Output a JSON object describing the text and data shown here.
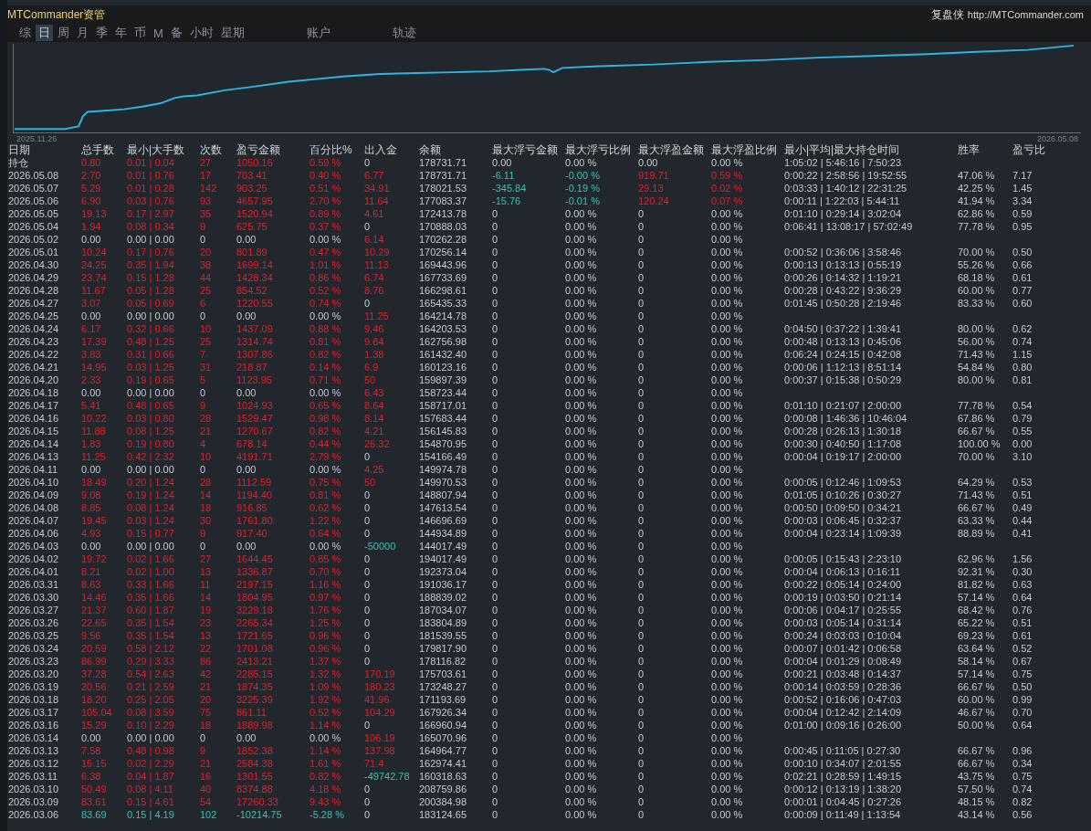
{
  "window": {
    "title": "MTCommander资管",
    "brand": "复盘侠",
    "url": "http://MTCommander.com"
  },
  "tabs": [
    {
      "label": "综",
      "selected": false
    },
    {
      "label": "日",
      "selected": true
    },
    {
      "label": "周",
      "selected": false
    },
    {
      "label": "月",
      "selected": false
    },
    {
      "label": "季",
      "selected": false
    },
    {
      "label": "年",
      "selected": false
    },
    {
      "label": "币",
      "selected": false
    },
    {
      "label": "M",
      "selected": false
    },
    {
      "label": "备",
      "selected": false
    },
    {
      "label": "小时",
      "selected": false
    },
    {
      "label": "星期",
      "selected": false
    },
    {
      "label": "账户",
      "selected": false
    },
    {
      "label": "轨迹",
      "selected": false
    }
  ],
  "chart": {
    "start_label": "2025.11.26",
    "end_label": "2026.05.08"
  },
  "table": {
    "columns": [
      "日期",
      "总手数",
      "最小|大手数",
      "次数",
      "盈亏金额",
      "百分比%",
      "出入金",
      "余额",
      "最大浮亏金额",
      "最大浮亏比例",
      "最大浮盈金额",
      "最大浮盈比例",
      "最小|平均|最大持仓时间",
      "胜率",
      "盈亏比"
    ],
    "rows": [
      {
        "kind": "gain",
        "deposit": false,
        "withdrawal": false,
        "floating": false,
        "cells": [
          "持仓",
          "0.80",
          "0.01 | 0.04",
          "27",
          "1050.16",
          "0.59 %",
          "0",
          "178731.71",
          "0.00",
          "0.00 %",
          "0.00",
          "0.00 %",
          "1:05:02 | 5:46:16 | 7:50:23"
        ]
      },
      {
        "kind": "gain",
        "deposit": true,
        "withdrawal": false,
        "floating": true,
        "cells": [
          "2026.05.08",
          "2.70",
          "0.01 | 0.76",
          "17",
          "703.41",
          "0.40 %",
          "6.77",
          "178731.71",
          "-6.11",
          "-0.00 %",
          "919.71",
          "0.59 %",
          "0:00:22 | 2:58:56 | 19:52:55",
          "47.06 %",
          "7.17"
        ]
      },
      {
        "kind": "gain",
        "deposit": true,
        "withdrawal": false,
        "floating": true,
        "cells": [
          "2026.05.07",
          "5.29",
          "0.01 | 0.28",
          "142",
          "903.25",
          "0.51 %",
          "34.91",
          "178021.53",
          "-345.84",
          "-0.19 %",
          "29.13",
          "0.02 %",
          "0:03:33 | 1:40:12 | 22:31:25",
          "42.25 %",
          "1.45"
        ]
      },
      {
        "kind": "gain",
        "deposit": true,
        "withdrawal": false,
        "floating": true,
        "cells": [
          "2026.05.06",
          "6.90",
          "0.03 | 0.76",
          "93",
          "4657.95",
          "2.70 %",
          "11.64",
          "177083.37",
          "-15.76",
          "-0.01 %",
          "120.24",
          "0.07 %",
          "0:00:11 | 1:22:03 | 5:44:11",
          "41.94 %",
          "3.34"
        ]
      },
      {
        "kind": "gain",
        "deposit": true,
        "withdrawal": false,
        "floating": false,
        "cells": [
          "2026.05.05",
          "19.13",
          "0.17 | 2.97",
          "35",
          "1520.94",
          "0.89 %",
          "4.61",
          "172413.78",
          "0",
          "0.00 %",
          "0",
          "0.00 %",
          "0:01:10 | 0:29:14 | 3:02:04",
          "62.86 %",
          "0.59"
        ]
      },
      {
        "kind": "gain",
        "deposit": false,
        "withdrawal": false,
        "floating": false,
        "cells": [
          "2026.05.04",
          "1.94",
          "0.08 | 0.34",
          "9",
          "625.75",
          "0.37 %",
          "0",
          "170888.03",
          "0",
          "0.00 %",
          "0",
          "0.00 %",
          "0:06:41 | 13:08:17 | 57:02:49",
          "77.78 %",
          "0.95"
        ]
      },
      {
        "kind": "flat",
        "deposit": true,
        "withdrawal": false,
        "floating": false,
        "cells": [
          "2026.05.02",
          "0.00",
          "0.00 | 0.00",
          "0",
          "0.00",
          "0.00 %",
          "6.14",
          "170262.28",
          "0",
          "0.00 %",
          "0",
          "0.00 %"
        ]
      },
      {
        "kind": "gain",
        "deposit": true,
        "withdrawal": false,
        "floating": false,
        "cells": [
          "2026.05.01",
          "10.24",
          "0.17 | 0.76",
          "20",
          "801.89",
          "0.47 %",
          "10.29",
          "170256.14",
          "0",
          "0.00 %",
          "0",
          "0.00 %",
          "0:00:52 | 0:36:06 | 3:58:46",
          "70.00 %",
          "0.50"
        ]
      },
      {
        "kind": "gain",
        "deposit": true,
        "withdrawal": false,
        "floating": false,
        "cells": [
          "2026.04.30",
          "24.25",
          "0.35 | 1.94",
          "38",
          "1699.14",
          "1.01 %",
          "11.13",
          "169443.96",
          "0",
          "0.00 %",
          "0",
          "0.00 %",
          "0:00:13 | 0:13:13 | 0:55:19",
          "55.26 %",
          "0.66"
        ]
      },
      {
        "kind": "gain",
        "deposit": true,
        "withdrawal": false,
        "floating": false,
        "cells": [
          "2026.04.29",
          "23.74",
          "0.15 | 1.28",
          "44",
          "1428.34",
          "0.86 %",
          "6.74",
          "167733.69",
          "0",
          "0.00 %",
          "0",
          "0.00 %",
          "0:00:26 | 0:14:32 | 1:19:21",
          "68.18 %",
          "0.61"
        ]
      },
      {
        "kind": "gain",
        "deposit": true,
        "withdrawal": false,
        "floating": false,
        "cells": [
          "2026.04.28",
          "11.67",
          "0.05 | 1.28",
          "25",
          "854.52",
          "0.52 %",
          "8.76",
          "166298.61",
          "0",
          "0.00 %",
          "0",
          "0.00 %",
          "0:00:28 | 0:43:22 | 9:36:29",
          "60.00 %",
          "0.77"
        ]
      },
      {
        "kind": "gain",
        "deposit": false,
        "withdrawal": false,
        "floating": false,
        "cells": [
          "2026.04.27",
          "3.07",
          "0.05 | 0.69",
          "6",
          "1220.55",
          "0.74 %",
          "0",
          "165435.33",
          "0",
          "0.00 %",
          "0",
          "0.00 %",
          "0:01:45 | 0:50:28 | 2:19:46",
          "83.33 %",
          "0.60"
        ]
      },
      {
        "kind": "flat",
        "deposit": true,
        "withdrawal": false,
        "floating": false,
        "cells": [
          "2026.04.25",
          "0.00",
          "0.00 | 0.00",
          "0",
          "0.00",
          "0.00 %",
          "11.25",
          "164214.78",
          "0",
          "0.00 %",
          "0",
          "0.00 %"
        ]
      },
      {
        "kind": "gain",
        "deposit": true,
        "withdrawal": false,
        "floating": false,
        "cells": [
          "2026.04.24",
          "6.17",
          "0.32 | 0.66",
          "10",
          "1437.09",
          "0.88 %",
          "9.46",
          "164203.53",
          "0",
          "0.00 %",
          "0",
          "0.00 %",
          "0:04:50 | 0:37:22 | 1:39:41",
          "80.00 %",
          "0.62"
        ]
      },
      {
        "kind": "gain",
        "deposit": true,
        "withdrawal": false,
        "floating": false,
        "cells": [
          "2026.04.23",
          "17.39",
          "0.48 | 1.25",
          "25",
          "1314.74",
          "0.81 %",
          "9.84",
          "162756.98",
          "0",
          "0.00 %",
          "0",
          "0.00 %",
          "0:00:48 | 0:13:13 | 0:45:06",
          "56.00 %",
          "0.74"
        ]
      },
      {
        "kind": "gain",
        "deposit": true,
        "withdrawal": false,
        "floating": false,
        "cells": [
          "2026.04.22",
          "3.83",
          "0.31 | 0.66",
          "7",
          "1307.86",
          "0.82 %",
          "1.38",
          "161432.40",
          "0",
          "0.00 %",
          "0",
          "0.00 %",
          "0:06:24 | 0:24:15 | 0:42:08",
          "71.43 %",
          "1.15"
        ]
      },
      {
        "kind": "gain",
        "deposit": true,
        "withdrawal": false,
        "floating": false,
        "cells": [
          "2026.04.21",
          "14.95",
          "0.03 | 1.25",
          "31",
          "218.87",
          "0.14 %",
          "6.9",
          "160123.16",
          "0",
          "0.00 %",
          "0",
          "0.00 %",
          "0:00:06 | 1:12:13 | 8:51:14",
          "54.84 %",
          "0.80"
        ]
      },
      {
        "kind": "gain",
        "deposit": true,
        "withdrawal": false,
        "floating": false,
        "cells": [
          "2026.04.20",
          "2.33",
          "0.19 | 0.65",
          "5",
          "1123.95",
          "0.71 %",
          "50",
          "159897.39",
          "0",
          "0.00 %",
          "0",
          "0.00 %",
          "0:00:37 | 0:15:38 | 0:50:29",
          "80.00 %",
          "0.81"
        ]
      },
      {
        "kind": "flat",
        "deposit": true,
        "withdrawal": false,
        "floating": false,
        "cells": [
          "2026.04.18",
          "0.00",
          "0.00 | 0.00",
          "0",
          "0.00",
          "0.00 %",
          "6.43",
          "158723.44",
          "0",
          "0.00 %",
          "0",
          "0.00 %"
        ]
      },
      {
        "kind": "gain",
        "deposit": true,
        "withdrawal": false,
        "floating": false,
        "cells": [
          "2026.04.17",
          "5.41",
          "0.48 | 0.65",
          "9",
          "1024.93",
          "0.65 %",
          "8.64",
          "158717.01",
          "0",
          "0.00 %",
          "0",
          "0.00 %",
          "0:01:10 | 0:21:07 | 2:00:00",
          "77.78 %",
          "0.54"
        ]
      },
      {
        "kind": "gain",
        "deposit": true,
        "withdrawal": false,
        "floating": false,
        "cells": [
          "2026.04.16",
          "10.22",
          "0.03 | 0.80",
          "28",
          "1529.47",
          "0.98 %",
          "8.14",
          "157683.44",
          "0",
          "0.00 %",
          "0",
          "0.00 %",
          "0:00:08 | 1:46:36 | 10:46:04",
          "67.86 %",
          "0.79"
        ]
      },
      {
        "kind": "gain",
        "deposit": true,
        "withdrawal": false,
        "floating": false,
        "cells": [
          "2026.04.15",
          "11.88",
          "0.08 | 1.25",
          "21",
          "1270.67",
          "0.82 %",
          "4.21",
          "156145.83",
          "0",
          "0.00 %",
          "0",
          "0.00 %",
          "0:00:28 | 0:26:13 | 1:30:18",
          "66.67 %",
          "0.55"
        ]
      },
      {
        "kind": "gain",
        "deposit": true,
        "withdrawal": false,
        "floating": false,
        "cells": [
          "2026.04.14",
          "1.83",
          "0.19 | 0.80",
          "4",
          "678.14",
          "0.44 %",
          "26.32",
          "154870.95",
          "0",
          "0.00 %",
          "0",
          "0.00 %",
          "0:00:30 | 0:40:50 | 1:17:08",
          "100.00 %",
          "0.00"
        ]
      },
      {
        "kind": "gain",
        "deposit": false,
        "withdrawal": false,
        "floating": false,
        "cells": [
          "2026.04.13",
          "11.25",
          "0.42 | 2.32",
          "10",
          "4191.71",
          "2.79 %",
          "0",
          "154166.49",
          "0",
          "0.00 %",
          "0",
          "0.00 %",
          "0:00:04 | 0:19:17 | 2:00:00",
          "70.00 %",
          "3.10"
        ]
      },
      {
        "kind": "flat",
        "deposit": true,
        "withdrawal": false,
        "floating": false,
        "cells": [
          "2026.04.11",
          "0.00",
          "0.00 | 0.00",
          "0",
          "0.00",
          "0.00 %",
          "4.25",
          "149974.78",
          "0",
          "0.00 %",
          "0",
          "0.00 %"
        ]
      },
      {
        "kind": "gain",
        "deposit": true,
        "withdrawal": false,
        "floating": false,
        "cells": [
          "2026.04.10",
          "18.49",
          "0.20 | 1.24",
          "28",
          "1112.59",
          "0.75 %",
          "50",
          "149970.53",
          "0",
          "0.00 %",
          "0",
          "0.00 %",
          "0:00:05 | 0:12:46 | 1:09:53",
          "64.29 %",
          "0.53"
        ]
      },
      {
        "kind": "gain",
        "deposit": false,
        "withdrawal": false,
        "floating": false,
        "cells": [
          "2026.04.09",
          "9.08",
          "0.19 | 1.24",
          "14",
          "1194.40",
          "0.81 %",
          "0",
          "148807.94",
          "0",
          "0.00 %",
          "0",
          "0.00 %",
          "0:01:05 | 0:10:26 | 0:30:27",
          "71.43 %",
          "0.51"
        ]
      },
      {
        "kind": "gain",
        "deposit": false,
        "withdrawal": false,
        "floating": false,
        "cells": [
          "2026.04.08",
          "8.85",
          "0.08 | 1.24",
          "18",
          "916.85",
          "0.62 %",
          "0",
          "147613.54",
          "0",
          "0.00 %",
          "0",
          "0.00 %",
          "0:00:50 | 0:09:50 | 0:34:21",
          "66.67 %",
          "0.49"
        ]
      },
      {
        "kind": "gain",
        "deposit": false,
        "withdrawal": false,
        "floating": false,
        "cells": [
          "2026.04.07",
          "19.45",
          "0.03 | 1.24",
          "30",
          "1761.80",
          "1.22 %",
          "0",
          "146696.69",
          "0",
          "0.00 %",
          "0",
          "0.00 %",
          "0:00:03 | 0:06:45 | 0:32:37",
          "63.33 %",
          "0.44"
        ]
      },
      {
        "kind": "gain",
        "deposit": false,
        "withdrawal": false,
        "floating": false,
        "cells": [
          "2026.04.06",
          "4.93",
          "0.15 | 0.77",
          "9",
          "917.40",
          "0.64 %",
          "0",
          "144934.89",
          "0",
          "0.00 %",
          "0",
          "0.00 %",
          "0:00:04 | 0:23:14 | 1:09:39",
          "88.89 %",
          "0.41"
        ]
      },
      {
        "kind": "flat",
        "deposit": false,
        "withdrawal": true,
        "floating": false,
        "cells": [
          "2026.04.03",
          "0.00",
          "0.00 | 0.00",
          "0",
          "0.00",
          "0.00 %",
          "-50000",
          "144017.49",
          "0",
          "0.00 %",
          "0",
          "0.00 %"
        ]
      },
      {
        "kind": "gain",
        "deposit": false,
        "withdrawal": false,
        "floating": false,
        "cells": [
          "2026.04.02",
          "19.72",
          "0.02 | 1.66",
          "27",
          "1644.45",
          "0.85 %",
          "0",
          "194017.49",
          "0",
          "0.00 %",
          "0",
          "0.00 %",
          "0:00:05 | 0:15:43 | 2:23:10",
          "62.96 %",
          "1.56"
        ]
      },
      {
        "kind": "gain",
        "deposit": false,
        "withdrawal": false,
        "floating": false,
        "cells": [
          "2026.04.01",
          "8.21",
          "0.02 | 1.00",
          "13",
          "1336.87",
          "0.70 %",
          "0",
          "192373.04",
          "0",
          "0.00 %",
          "0",
          "0.00 %",
          "0:00:04 | 0:06:13 | 0:16:11",
          "92.31 %",
          "0.30"
        ]
      },
      {
        "kind": "gain",
        "deposit": false,
        "withdrawal": false,
        "floating": false,
        "cells": [
          "2026.03.31",
          "8.63",
          "0.33 | 1.66",
          "11",
          "2197.15",
          "1.16 %",
          "0",
          "191036.17",
          "0",
          "0.00 %",
          "0",
          "0.00 %",
          "0:00:22 | 0:05:14 | 0:24:00",
          "81.82 %",
          "0.63"
        ]
      },
      {
        "kind": "gain",
        "deposit": false,
        "withdrawal": false,
        "floating": false,
        "cells": [
          "2026.03.30",
          "14.46",
          "0.35 | 1.66",
          "14",
          "1804.95",
          "0.97 %",
          "0",
          "188839.02",
          "0",
          "0.00 %",
          "0",
          "0.00 %",
          "0:00:19 | 0:03:50 | 0:21:14",
          "57.14 %",
          "0.64"
        ]
      },
      {
        "kind": "gain",
        "deposit": false,
        "withdrawal": false,
        "floating": false,
        "cells": [
          "2026.03.27",
          "21.37",
          "0.60 | 1.87",
          "19",
          "3229.18",
          "1.76 %",
          "0",
          "187034.07",
          "0",
          "0.00 %",
          "0",
          "0.00 %",
          "0:00:06 | 0:04:17 | 0:25:55",
          "68.42 %",
          "0.76"
        ]
      },
      {
        "kind": "gain",
        "deposit": false,
        "withdrawal": false,
        "floating": false,
        "cells": [
          "2026.03.26",
          "22.65",
          "0.35 | 1.54",
          "23",
          "2265.34",
          "1.25 %",
          "0",
          "183804.89",
          "0",
          "0.00 %",
          "0",
          "0.00 %",
          "0:00:03 | 0:05:14 | 0:31:14",
          "65.22 %",
          "0.51"
        ]
      },
      {
        "kind": "gain",
        "deposit": false,
        "withdrawal": false,
        "floating": false,
        "cells": [
          "2026.03.25",
          "9.56",
          "0.35 | 1.54",
          "13",
          "1721.65",
          "0.96 %",
          "0",
          "181539.55",
          "0",
          "0.00 %",
          "0",
          "0.00 %",
          "0:00:24 | 0:03:03 | 0:10:04",
          "69.23 %",
          "0.61"
        ]
      },
      {
        "kind": "gain",
        "deposit": false,
        "withdrawal": false,
        "floating": false,
        "cells": [
          "2026.03.24",
          "20.59",
          "0.58 | 2.12",
          "22",
          "1701.08",
          "0.96 %",
          "0",
          "179817.90",
          "0",
          "0.00 %",
          "0",
          "0.00 %",
          "0:00:07 | 0:01:42 | 0:06:58",
          "63.64 %",
          "0.52"
        ]
      },
      {
        "kind": "gain",
        "deposit": false,
        "withdrawal": false,
        "floating": false,
        "cells": [
          "2026.03.23",
          "86.99",
          "0.29 | 3.33",
          "86",
          "2413.21",
          "1.37 %",
          "0",
          "178116.82",
          "0",
          "0.00 %",
          "0",
          "0.00 %",
          "0:00:04 | 0:01:29 | 0:08:49",
          "58.14 %",
          "0.67"
        ]
      },
      {
        "kind": "gain",
        "deposit": true,
        "withdrawal": false,
        "floating": false,
        "cells": [
          "2026.03.20",
          "37.28",
          "0.54 | 2.63",
          "42",
          "2285.15",
          "1.32 %",
          "170.19",
          "175703.61",
          "0",
          "0.00 %",
          "0",
          "0.00 %",
          "0:00:21 | 0:03:48 | 0:14:37",
          "57.14 %",
          "0.75"
        ]
      },
      {
        "kind": "gain",
        "deposit": true,
        "withdrawal": false,
        "floating": false,
        "cells": [
          "2026.03.19",
          "20.56",
          "0.21 | 2.59",
          "21",
          "1874.35",
          "1.09 %",
          "180.23",
          "173248.27",
          "0",
          "0.00 %",
          "0",
          "0.00 %",
          "0:00:14 | 0:03:59 | 0:28:36",
          "66.67 %",
          "0.50"
        ]
      },
      {
        "kind": "gain",
        "deposit": true,
        "withdrawal": false,
        "floating": false,
        "cells": [
          "2026.03.18",
          "18.20",
          "0.25 | 2.05",
          "20",
          "3225.39",
          "1.92 %",
          "41.96",
          "171193.69",
          "0",
          "0.00 %",
          "0",
          "0.00 %",
          "0:00:52 | 0:16:06 | 0:47:03",
          "60.00 %",
          "0.99"
        ]
      },
      {
        "kind": "gain",
        "deposit": true,
        "withdrawal": false,
        "floating": false,
        "cells": [
          "2026.03.17",
          "105.04",
          "0.08 | 3.59",
          "75",
          "861.11",
          "0.52 %",
          "104.29",
          "167926.34",
          "0",
          "0.00 %",
          "0",
          "0.00 %",
          "0:00:04 | 0:12:42 | 2:14:09",
          "46.67 %",
          "0.70"
        ]
      },
      {
        "kind": "gain",
        "deposit": false,
        "withdrawal": false,
        "floating": false,
        "cells": [
          "2026.03.16",
          "15.29",
          "0.10 | 2.29",
          "18",
          "1889.98",
          "1.14 %",
          "0",
          "166960.94",
          "0",
          "0.00 %",
          "0",
          "0.00 %",
          "0:01:00 | 0:09:16 | 0:26:00",
          "50.00 %",
          "0.64"
        ]
      },
      {
        "kind": "flat",
        "deposit": true,
        "withdrawal": false,
        "floating": false,
        "cells": [
          "2026.03.14",
          "0.00",
          "0.00 | 0.00",
          "0",
          "0.00",
          "0.00 %",
          "106.19",
          "165070.96",
          "0",
          "0.00 %",
          "0",
          "0.00 %"
        ]
      },
      {
        "kind": "gain",
        "deposit": true,
        "withdrawal": false,
        "floating": false,
        "cells": [
          "2026.03.13",
          "7.58",
          "0.48 | 0.98",
          "9",
          "1852.38",
          "1.14 %",
          "137.98",
          "164964.77",
          "0",
          "0.00 %",
          "0",
          "0.00 %",
          "0:00:45 | 0:11:05 | 0:27:30",
          "66.67 %",
          "0.96"
        ]
      },
      {
        "kind": "gain",
        "deposit": true,
        "withdrawal": false,
        "floating": false,
        "cells": [
          "2026.03.12",
          "15.15",
          "0.02 | 2.29",
          "21",
          "2584.38",
          "1.61 %",
          "71.4",
          "162974.41",
          "0",
          "0.00 %",
          "0",
          "0.00 %",
          "0:00:10 | 0:34:07 | 2:01:55",
          "66.67 %",
          "0.34"
        ]
      },
      {
        "kind": "gain",
        "deposit": false,
        "withdrawal": true,
        "floating": false,
        "cells": [
          "2026.03.11",
          "6.38",
          "0.04 | 1.87",
          "16",
          "1301.55",
          "0.82 %",
          "-49742.78",
          "160318.63",
          "0",
          "0.00 %",
          "0",
          "0.00 %",
          "0:02:21 | 0:28:59 | 1:49:15",
          "43.75 %",
          "0.75"
        ]
      },
      {
        "kind": "gain",
        "deposit": false,
        "withdrawal": false,
        "floating": false,
        "cells": [
          "2026.03.10",
          "50.49",
          "0.08 | 4.11",
          "40",
          "8374.88",
          "4.18 %",
          "0",
          "208759.86",
          "0",
          "0.00 %",
          "0",
          "0.00 %",
          "0:00:12 | 0:13:19 | 1:38:20",
          "57.50 %",
          "0.74"
        ]
      },
      {
        "kind": "gain",
        "deposit": false,
        "withdrawal": false,
        "floating": false,
        "cells": [
          "2026.03.09",
          "83.61",
          "0.15 | 4.61",
          "54",
          "17260.33",
          "9.43 %",
          "0",
          "200384.98",
          "0",
          "0.00 %",
          "0",
          "0.00 %",
          "0:00:01 | 0:04:45 | 0:27:26",
          "48.15 %",
          "0.82"
        ]
      },
      {
        "kind": "loss",
        "deposit": false,
        "withdrawal": false,
        "floating": false,
        "cells": [
          "2026.03.06",
          "83.69",
          "0.15 | 4.19",
          "102",
          "-10214.75",
          "-5.28 %",
          "0",
          "183124.65",
          "0",
          "0.00 %",
          "0",
          "0.00 %",
          "0:00:09 | 0:11:49 | 1:13:54",
          "43.14 %",
          "0.56"
        ]
      }
    ]
  }
}
